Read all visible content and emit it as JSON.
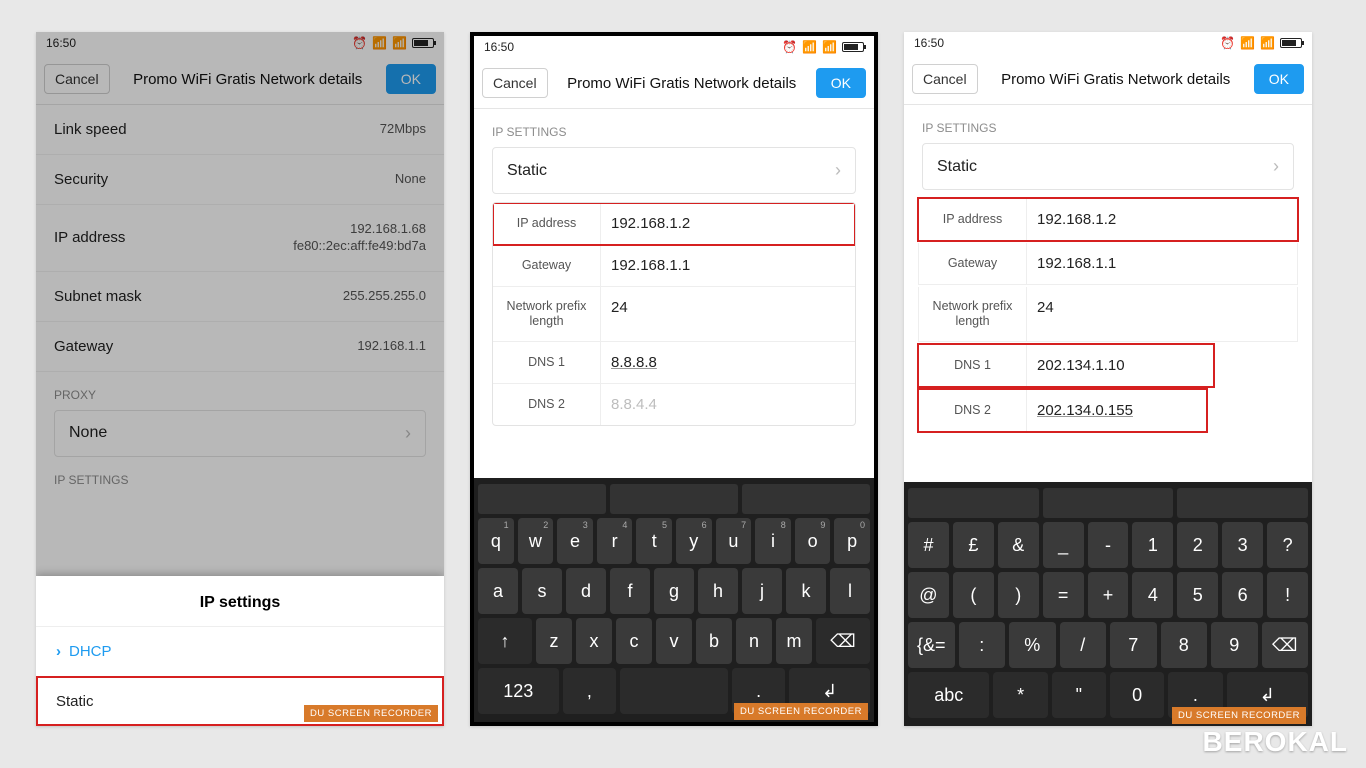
{
  "status": {
    "time": "16:50"
  },
  "header": {
    "cancel": "Cancel",
    "title": "Promo WiFi Gratis Network details",
    "ok": "OK"
  },
  "screen1": {
    "linkspeed_k": "Link speed",
    "linkspeed_v": "72Mbps",
    "security_k": "Security",
    "security_v": "None",
    "ip_k": "IP address",
    "ip_v": "192.168.1.68\nfe80::2ec:aff:fe49:bd7a",
    "subnet_k": "Subnet mask",
    "subnet_v": "255.255.255.0",
    "gateway_k": "Gateway",
    "gateway_v": "192.168.1.1",
    "proxy_label": "PROXY",
    "proxy_value": "None",
    "ipsettings_label": "IP SETTINGS",
    "sheet_title": "IP settings",
    "sheet_dhcp": "DHCP",
    "sheet_static": "Static"
  },
  "screen2": {
    "ipsettings_label": "IP SETTINGS",
    "static": "Static",
    "ip_k": "IP address",
    "ip_v": "192.168.1.2",
    "gw_k": "Gateway",
    "gw_v": "192.168.1.1",
    "pref_k": "Network prefix length",
    "pref_v": "24",
    "dns1_k": "DNS 1",
    "dns1_v": "8.8.8.8",
    "dns2_k": "DNS 2",
    "dns2_v": "8.8.4.4",
    "kb_rows": [
      [
        {
          "m": "q",
          "s": "1"
        },
        {
          "m": "w",
          "s": "2"
        },
        {
          "m": "e",
          "s": "3"
        },
        {
          "m": "r",
          "s": "4"
        },
        {
          "m": "t",
          "s": "5"
        },
        {
          "m": "y",
          "s": "6"
        },
        {
          "m": "u",
          "s": "7"
        },
        {
          "m": "i",
          "s": "8"
        },
        {
          "m": "o",
          "s": "9"
        },
        {
          "m": "p",
          "s": "0"
        }
      ],
      [
        {
          "m": "a"
        },
        {
          "m": "s"
        },
        {
          "m": "d"
        },
        {
          "m": "f"
        },
        {
          "m": "g"
        },
        {
          "m": "h"
        },
        {
          "m": "j"
        },
        {
          "m": "k"
        },
        {
          "m": "l"
        }
      ],
      [
        {
          "m": "z"
        },
        {
          "m": "x"
        },
        {
          "m": "c"
        },
        {
          "m": "v"
        },
        {
          "m": "b"
        },
        {
          "m": "n"
        },
        {
          "m": "m"
        }
      ]
    ],
    "kb_shift": "↑",
    "kb_123": "123",
    "kb_bksp": "⌫"
  },
  "screen3": {
    "ipsettings_label": "IP SETTINGS",
    "static": "Static",
    "ip_k": "IP address",
    "ip_v": "192.168.1.2",
    "gw_k": "Gateway",
    "gw_v": "192.168.1.1",
    "pref_k": "Network prefix length",
    "pref_v": "24",
    "dns1_k": "DNS 1",
    "dns1_v": "202.134.1.10",
    "dns2_k": "DNS 2",
    "dns2_v": "202.134.0.155",
    "kb_rows": [
      [
        {
          "m": "#"
        },
        {
          "m": "£"
        },
        {
          "m": "&"
        },
        {
          "m": "_"
        },
        {
          "m": "-"
        },
        {
          "m": "1"
        },
        {
          "m": "2"
        },
        {
          "m": "3"
        },
        {
          "m": "?"
        }
      ],
      [
        {
          "m": "@"
        },
        {
          "m": "("
        },
        {
          "m": ")"
        },
        {
          "m": "="
        },
        {
          "m": "+"
        },
        {
          "m": "4"
        },
        {
          "m": "5"
        },
        {
          "m": "6"
        },
        {
          "m": "!"
        }
      ],
      [
        {
          "m": "{&="
        },
        {
          "m": ":"
        },
        {
          "m": "%"
        },
        {
          "m": "/"
        },
        {
          "m": "7"
        },
        {
          "m": "8"
        },
        {
          "m": "9"
        },
        {
          "m": "⌫"
        }
      ]
    ],
    "kb_abc": "abc",
    "kb_star": "*",
    "kb_comma": "\"",
    "kb_zero": "0",
    "kb_dot": ".",
    "kb_enter": "↲"
  },
  "recorder": "DU SCREEN RECORDER",
  "watermark": "BEROKAL"
}
